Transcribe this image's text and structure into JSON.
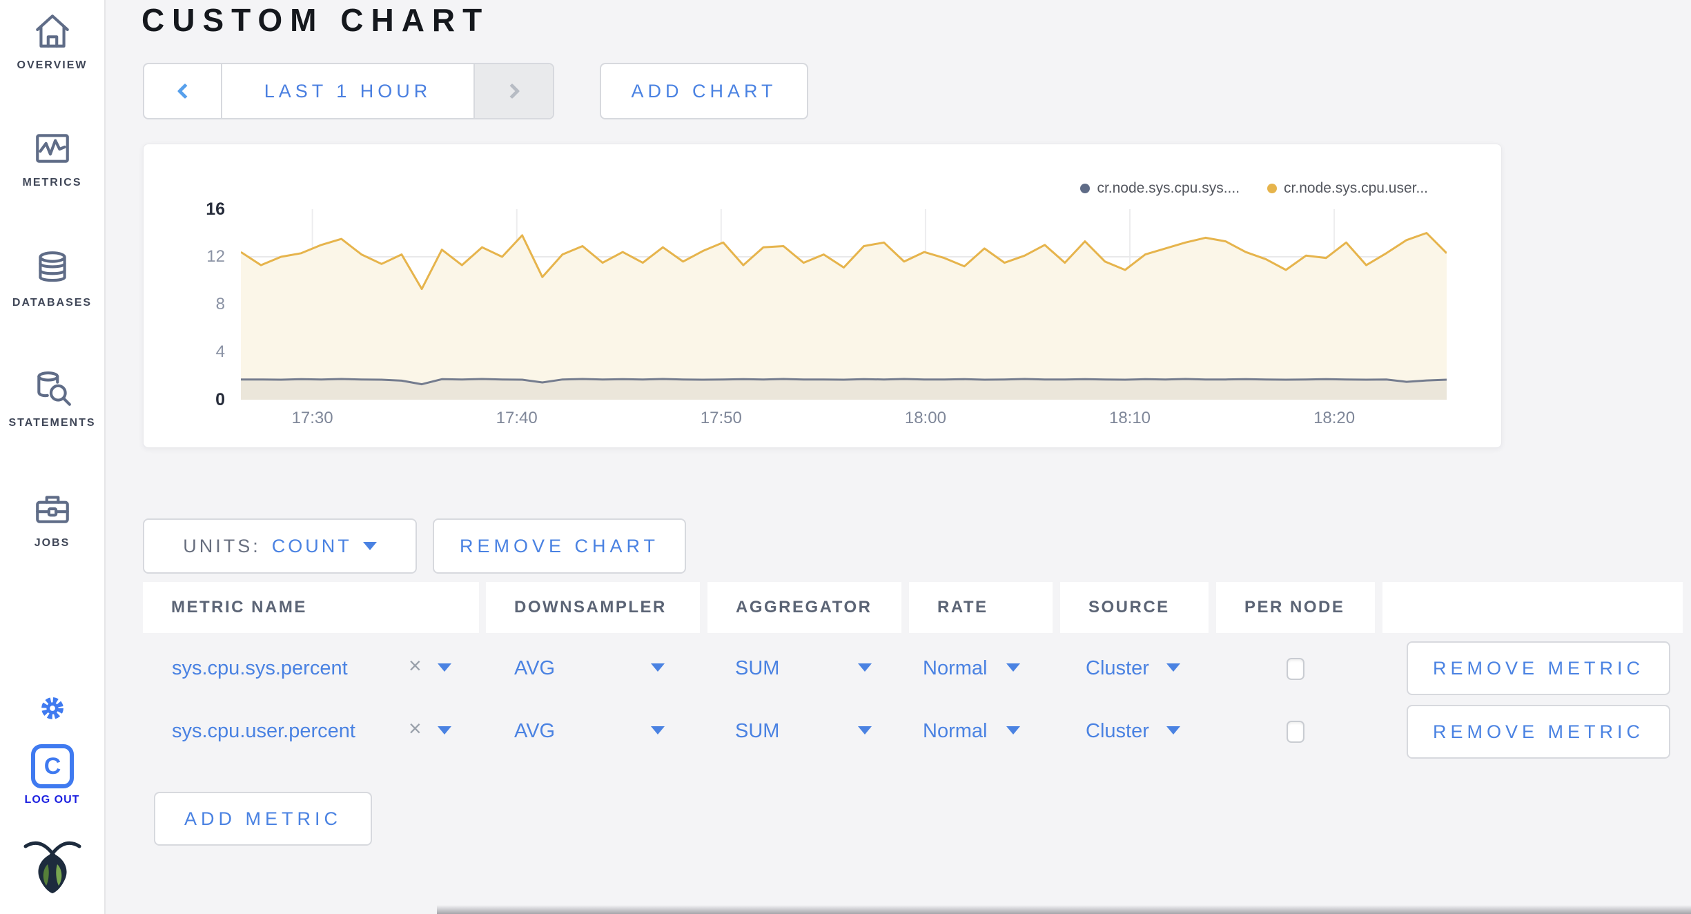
{
  "sidebar": {
    "items": [
      {
        "label": "OVERVIEW"
      },
      {
        "label": "METRICS"
      },
      {
        "label": "DATABASES"
      },
      {
        "label": "STATEMENTS"
      },
      {
        "label": "JOBS"
      }
    ],
    "logout_label": "LOG OUT",
    "logo_letter": "C"
  },
  "header": {
    "title": "CUSTOM CHART"
  },
  "toolbar": {
    "time_range_label": "LAST 1 HOUR",
    "add_chart_label": "ADD CHART"
  },
  "chart_controls": {
    "units_label": "UNITS:",
    "units_value": "COUNT",
    "remove_chart_label": "REMOVE CHART",
    "add_metric_label": "ADD METRIC",
    "clear_icon": "×"
  },
  "icons": {
    "sidebar": [
      "home-icon",
      "chart-pulse-icon",
      "database-icon",
      "database-search-icon",
      "briefcase-icon"
    ],
    "settings": "gear-icon",
    "logout": "c-logo-icon",
    "brand": "cockroach-bug-icon",
    "time_prev": "chevron-left-icon",
    "time_next": "chevron-right-icon",
    "dropdown": "caret-down-icon",
    "clear": "x-icon"
  },
  "legend": [
    {
      "label": "cr.node.sys.cpu.sys....",
      "color": "#5f6c87"
    },
    {
      "label": "cr.node.sys.cpu.user...",
      "color": "#e6b44c"
    }
  ],
  "table": {
    "columns": [
      "METRIC NAME",
      "DOWNSAMPLER",
      "AGGREGATOR",
      "RATE",
      "SOURCE",
      "PER NODE",
      ""
    ],
    "rows": [
      {
        "metric": "sys.cpu.sys.percent",
        "downsampler": "AVG",
        "aggregator": "SUM",
        "rate": "Normal",
        "source": "Cluster",
        "per_node_checked": false,
        "remove_label": "REMOVE METRIC"
      },
      {
        "metric": "sys.cpu.user.percent",
        "downsampler": "AVG",
        "aggregator": "SUM",
        "rate": "Normal",
        "source": "Cluster",
        "per_node_checked": false,
        "remove_label": "REMOVE METRIC"
      }
    ]
  },
  "chart_data": {
    "type": "line",
    "title": "",
    "xlabel": "",
    "ylabel": "",
    "x_start": "17:26:30",
    "x_end": "18:25:30",
    "x_ticks": [
      "17:30",
      "17:40",
      "17:50",
      "18:00",
      "18:10",
      "18:20"
    ],
    "ylim": [
      0,
      16
    ],
    "y_ticks": [
      0,
      4,
      8,
      12,
      16
    ],
    "grid": true,
    "legend_position": "top-right",
    "series": [
      {
        "name": "cr.node.sys.cpu.sys.percent",
        "color": "#747c8e",
        "fill": "#ebe6da",
        "values": [
          1.7,
          1.7,
          1.68,
          1.72,
          1.7,
          1.74,
          1.7,
          1.68,
          1.6,
          1.3,
          1.72,
          1.7,
          1.74,
          1.7,
          1.68,
          1.45,
          1.7,
          1.74,
          1.7,
          1.72,
          1.7,
          1.74,
          1.7,
          1.68,
          1.7,
          1.72,
          1.7,
          1.74,
          1.7,
          1.7,
          1.68,
          1.72,
          1.7,
          1.74,
          1.7,
          1.7,
          1.72,
          1.68,
          1.7,
          1.74,
          1.7,
          1.7,
          1.72,
          1.7,
          1.68,
          1.72,
          1.7,
          1.74,
          1.7,
          1.7,
          1.72,
          1.7,
          1.68,
          1.7,
          1.72,
          1.7,
          1.68,
          1.7,
          1.5,
          1.62,
          1.68
        ]
      },
      {
        "name": "cr.node.sys.cpu.user.percent",
        "color": "#e6b44c",
        "fill": "#fbf6e8",
        "values": [
          12.4,
          11.3,
          12.0,
          12.3,
          13.0,
          13.5,
          12.2,
          11.4,
          12.2,
          9.3,
          12.6,
          11.3,
          12.8,
          12.0,
          13.8,
          10.3,
          12.2,
          12.9,
          11.5,
          12.4,
          11.5,
          12.8,
          11.6,
          12.5,
          13.2,
          11.3,
          12.8,
          12.9,
          11.5,
          12.2,
          11.1,
          12.9,
          13.2,
          11.6,
          12.4,
          11.9,
          11.2,
          12.7,
          11.5,
          12.1,
          13.0,
          11.5,
          13.3,
          11.6,
          10.9,
          12.2,
          12.7,
          13.2,
          13.6,
          13.3,
          12.4,
          11.8,
          10.9,
          12.1,
          11.9,
          13.2,
          11.3,
          12.3,
          13.4,
          14.0,
          12.3
        ]
      }
    ]
  }
}
